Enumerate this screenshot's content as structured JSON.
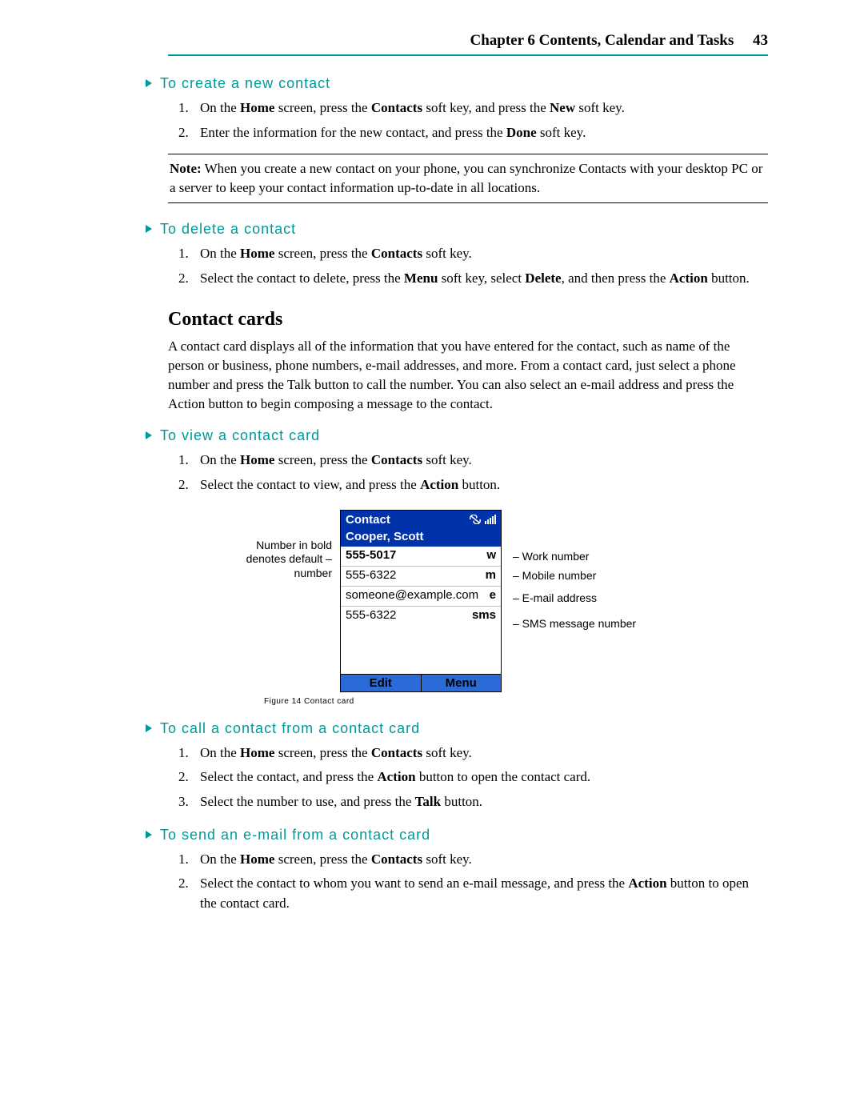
{
  "header": {
    "chapter": "Chapter 6 Contents, Calendar and Tasks",
    "page_number": "43"
  },
  "proc_create": {
    "title": "To create a new contact",
    "steps": {
      "s1_pre": "On the ",
      "s1_b1": "Home",
      "s1_mid1": " screen, press the ",
      "s1_b2": "Contacts",
      "s1_mid2": " soft key, and press the ",
      "s1_b3": "New",
      "s1_post": " soft key.",
      "s2_pre": "Enter the information for the new contact, and press the ",
      "s2_b1": "Done",
      "s2_post": " soft key."
    }
  },
  "note": {
    "label": "Note:",
    "text": " When you create a new contact on your phone, you can synchronize Contacts with your desktop PC or a server to keep your contact information up-to-date in all locations."
  },
  "proc_delete": {
    "title": "To delete a contact",
    "s1_pre": "On the ",
    "s1_b1": "Home",
    "s1_mid1": " screen, press the ",
    "s1_b2": "Contacts",
    "s1_post": " soft key.",
    "s2_pre": "Select the contact to delete, press the ",
    "s2_b1": "Menu",
    "s2_mid1": " soft key, select ",
    "s2_b2": "Delete",
    "s2_mid2": ", and then press the ",
    "s2_b3": "Action",
    "s2_post": " button."
  },
  "cards": {
    "heading": "Contact cards",
    "para": "A contact card displays all of the information that you have entered for the contact, such as name of the person or business, phone numbers, e-mail addresses, and more. From a contact card, just select a phone number and press the Talk button to call the number. You can also select an e-mail address and press the Action button to begin composing a message to the contact."
  },
  "proc_view": {
    "title": "To view a contact card",
    "s1_pre": "On the ",
    "s1_b1": "Home",
    "s1_mid1": " screen, press the ",
    "s1_b2": "Contacts",
    "s1_post": " soft key.",
    "s2_pre": "Select the contact to view, and press the ",
    "s2_b1": "Action",
    "s2_post": " button."
  },
  "figure": {
    "left_callout_l1": "Number in bold",
    "left_callout_l2": "denotes default",
    "left_callout_l3": "number",
    "phone_title": "Contact",
    "contact_name": "Cooper, Scott",
    "rows": [
      {
        "value": "555-5017",
        "tag": "w"
      },
      {
        "value": "555-6322",
        "tag": "m"
      },
      {
        "value": "someone@example.com",
        "tag": "e"
      },
      {
        "value": "555-6322",
        "tag": "sms"
      }
    ],
    "soft_left": "Edit",
    "soft_right": "Menu",
    "right_r1": "– Work number",
    "right_r2": "– Mobile number",
    "right_r3": "– E-mail address",
    "right_r4": "– SMS message number",
    "caption": "Figure 14 Contact card"
  },
  "proc_call": {
    "title": "To call a contact from a contact card",
    "s1_pre": "On the ",
    "s1_b1": "Home",
    "s1_mid1": " screen, press the ",
    "s1_b2": "Contacts",
    "s1_post": " soft key.",
    "s2_pre": "Select the contact, and press the ",
    "s2_b1": "Action",
    "s2_post": " button to open the contact card.",
    "s3_pre": "Select the number to use, and press the ",
    "s3_b1": "Talk",
    "s3_post": " button."
  },
  "proc_email": {
    "title": "To send an e-mail from a contact card",
    "s1_pre": "On the ",
    "s1_b1": "Home",
    "s1_mid1": " screen, press the ",
    "s1_b2": "Contacts",
    "s1_post": " soft key.",
    "s2_pre": "Select the contact to whom you want to send an e-mail message, and press the ",
    "s2_b1": "Action",
    "s2_post": " button to open the contact card."
  }
}
